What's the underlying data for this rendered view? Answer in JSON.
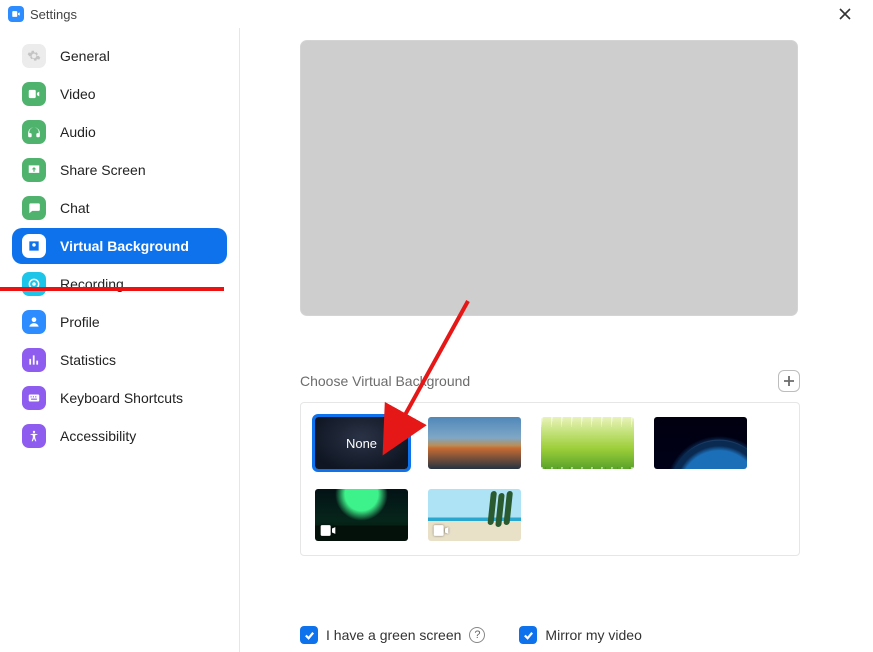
{
  "app": {
    "title": "Settings"
  },
  "sidebar": {
    "items": [
      {
        "label": "General"
      },
      {
        "label": "Video"
      },
      {
        "label": "Audio"
      },
      {
        "label": "Share Screen"
      },
      {
        "label": "Chat"
      },
      {
        "label": "Virtual Background"
      },
      {
        "label": "Recording"
      },
      {
        "label": "Profile"
      },
      {
        "label": "Statistics"
      },
      {
        "label": "Keyboard Shortcuts"
      },
      {
        "label": "Accessibility"
      }
    ],
    "active_index": 5
  },
  "main": {
    "section_title": "Choose Virtual Background",
    "backgrounds": [
      {
        "label": "None",
        "is_video": false
      },
      {
        "label": "",
        "is_video": false
      },
      {
        "label": "",
        "is_video": false
      },
      {
        "label": "",
        "is_video": false
      },
      {
        "label": "",
        "is_video": true
      },
      {
        "label": "",
        "is_video": true
      }
    ],
    "selected_index": 0,
    "options": {
      "green_screen": {
        "label": "I have a green screen",
        "checked": true
      },
      "mirror": {
        "label": "Mirror my video",
        "checked": true
      }
    }
  }
}
